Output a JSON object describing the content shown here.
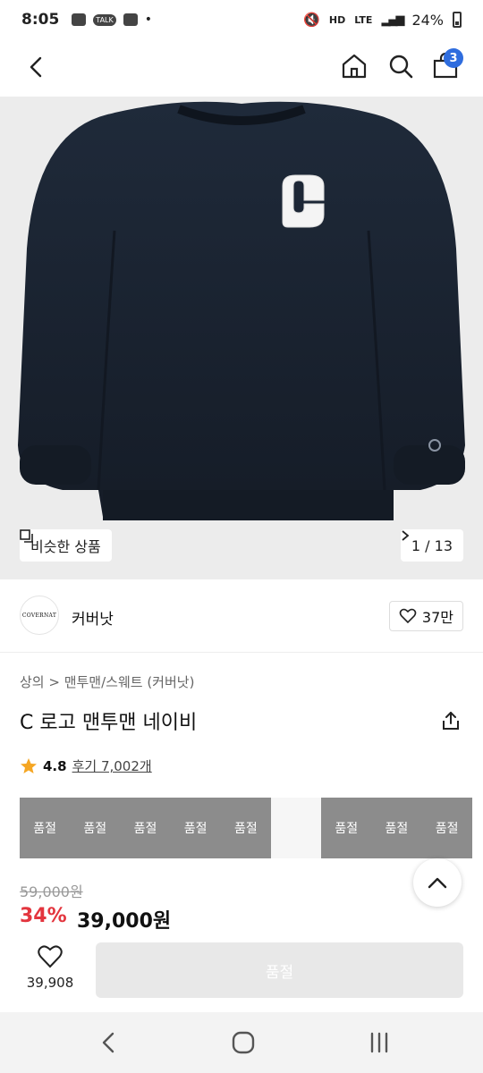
{
  "status_bar": {
    "time": "8:05",
    "talk_label": "TALK",
    "dot": "•",
    "network_hd": "HD",
    "network_lte": "LTE",
    "battery": "24%"
  },
  "nav": {
    "cart_count": "3"
  },
  "gallery": {
    "similar_label": "비슷한 상품",
    "counter": "1 / 13"
  },
  "brand": {
    "logo_text": "COVERNAT",
    "name": "커버낫",
    "likes": "37만"
  },
  "product": {
    "breadcrumb": "상의 > 맨투맨/스웨트 (커버낫)",
    "title": "C 로고 맨투맨 네이비",
    "rating": "4.8",
    "reviews": "후기 7,002개",
    "sold_labels": [
      "품절",
      "품절",
      "품절",
      "품절",
      "품절",
      "",
      "품절",
      "품절",
      "품절"
    ],
    "original_price": "59,000원",
    "discount": "34%",
    "price": "39,000원"
  },
  "bottom": {
    "wish_count": "39,908",
    "buy_label": "품절"
  },
  "colors": {
    "accent": "#2f6dde",
    "discount": "#e3353e",
    "sweater": "#1c2533"
  }
}
